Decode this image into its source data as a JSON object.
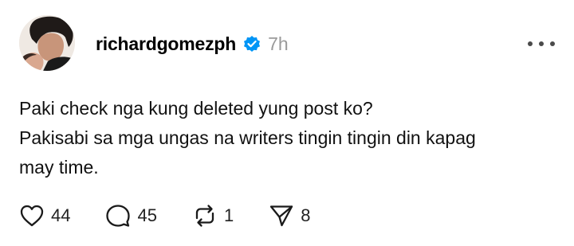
{
  "post": {
    "username": "richardgomezph",
    "verified": true,
    "timestamp": "7h",
    "text_lines": [
      "Paki check nga kung deleted yung post ko?",
      "Pakisabi sa mga ungas na writers tingin tingin din kapag",
      "may time."
    ]
  },
  "actions": {
    "like": {
      "icon": "heart-icon",
      "count": "44"
    },
    "comment": {
      "icon": "comment-icon",
      "count": "45"
    },
    "repost": {
      "icon": "repost-icon",
      "count": "1"
    },
    "share": {
      "icon": "send-icon",
      "count": "8"
    }
  },
  "colors": {
    "verified_blue": "#0095f6",
    "timestamp_gray": "#9a9a9a",
    "text": "#111111"
  }
}
